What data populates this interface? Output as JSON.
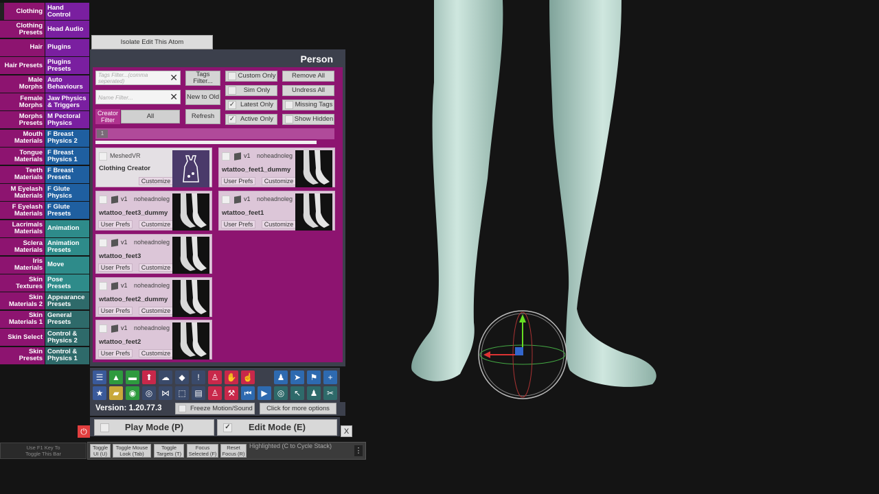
{
  "left_tabs": [
    {
      "l": "Clothing",
      "r": "Hand\nControl"
    },
    {
      "l": "Clothing\nPresets",
      "r": "Head Audio"
    },
    {
      "l": "Hair",
      "r": "Plugins"
    },
    {
      "l": "Hair Presets",
      "r": "Plugins\nPresets"
    },
    {
      "l": "Male\nMorphs",
      "r": "Auto\nBehaviours"
    },
    {
      "l": "Female\nMorphs",
      "r": "Jaw Physics\n& Triggers"
    },
    {
      "l": "Morphs\nPresets",
      "r": "M Pectoral\nPhysics"
    },
    {
      "l": "Mouth\nMaterials",
      "r": "F Breast\nPhysics 2"
    },
    {
      "l": "Tongue\nMaterials",
      "r": "F Breast\nPhysics 1"
    },
    {
      "l": "Teeth\nMaterials",
      "r": "F Breast\nPresets"
    },
    {
      "l": "M Eyelash\nMaterials",
      "r": "F Glute\nPhysics"
    },
    {
      "l": "F Eyelash\nMaterials",
      "r": "F Glute\nPresets"
    },
    {
      "l": "Lacrimals\nMaterials",
      "r": "Animation"
    },
    {
      "l": "Sclera\nMaterials",
      "r": "Animation\nPresets"
    },
    {
      "l": "Iris\nMaterials",
      "r": "Move"
    },
    {
      "l": "Skin\nTextures",
      "r": "Pose\nPresets"
    },
    {
      "l": "Skin\nMaterials 2",
      "r": "Appearance\nPresets"
    },
    {
      "l": "Skin\nMaterials 1",
      "r": "General\nPresets"
    },
    {
      "l": "Skin Select",
      "r": "Control &\nPhysics 2"
    },
    {
      "l": "Skin\nPresets",
      "r": "Control &\nPhysics 1"
    }
  ],
  "isolate_button": "Isolate Edit This Atom",
  "panel_title": "Person",
  "filters": {
    "tags_placeholder": "Tags Filter...(comma seperated)",
    "name_placeholder": "Name Filter...",
    "tags_button": "Tags\nFilter...",
    "sort_button": "New to Old",
    "creator_label": "Creator\nFilter",
    "creator_value": "All",
    "refresh": "Refresh",
    "custom_only": "Custom Only",
    "sim_only": "Sim Only",
    "latest_only": "Latest Only",
    "active_only": "Active Only",
    "remove_all": "Remove All",
    "undress_all": "Undress All",
    "missing_tags": "Missing Tags",
    "show_hidden": "Show Hidden",
    "page": "1"
  },
  "items": [
    {
      "author": "MeshedVR",
      "ver": "",
      "name": "Clothing Creator",
      "prefs": "",
      "customize": "Customize"
    },
    {
      "author": "noheadnoleg",
      "ver": "v1",
      "name": "wtattoo_feet1_dummy",
      "prefs": "User Prefs",
      "customize": "Customize"
    },
    {
      "author": "noheadnoleg",
      "ver": "v1",
      "name": "wtattoo_feet3_dummy",
      "prefs": "User Prefs",
      "customize": "Customize"
    },
    {
      "author": "noheadnoleg",
      "ver": "v1",
      "name": "wtattoo_feet1",
      "prefs": "User Prefs",
      "customize": "Customize"
    },
    {
      "author": "noheadnoleg",
      "ver": "v1",
      "name": "wtattoo_feet3",
      "prefs": "User Prefs",
      "customize": "Customize"
    },
    {
      "author": "noheadnoleg",
      "ver": "v1",
      "name": "wtattoo_feet2_dummy",
      "prefs": "User Prefs",
      "customize": "Customize"
    },
    {
      "author": "noheadnoleg",
      "ver": "v1",
      "name": "wtattoo_feet2",
      "prefs": "User Prefs",
      "customize": "Customize"
    }
  ],
  "toolbar": {
    "version": "Version: 1.20.77.3",
    "freeze": "Freeze Motion/Sound",
    "more": "Click for more options",
    "play": "Play Mode (P)",
    "edit": "Edit Mode (E)",
    "close": "X"
  },
  "footer": {
    "hint": "Use F1 Key To\nToggle This Bar",
    "toggle_ui": "Toggle\nUI (U)",
    "mouse_look": "Toggle Mouse\nLook (Tab)",
    "targets": "Toggle\nTargets (T)",
    "focus": "Focus\nSelected (F)",
    "reset": "Reset\nFocus (R)",
    "highlighted": "Highlighted (C to Cycle Stack)"
  },
  "colors": {
    "magenta": "#8d1470",
    "purple": "#7a1fa0",
    "panel": "#3a3e4a",
    "teal": "#2e8b8a",
    "blue": "#1f5fa0"
  }
}
